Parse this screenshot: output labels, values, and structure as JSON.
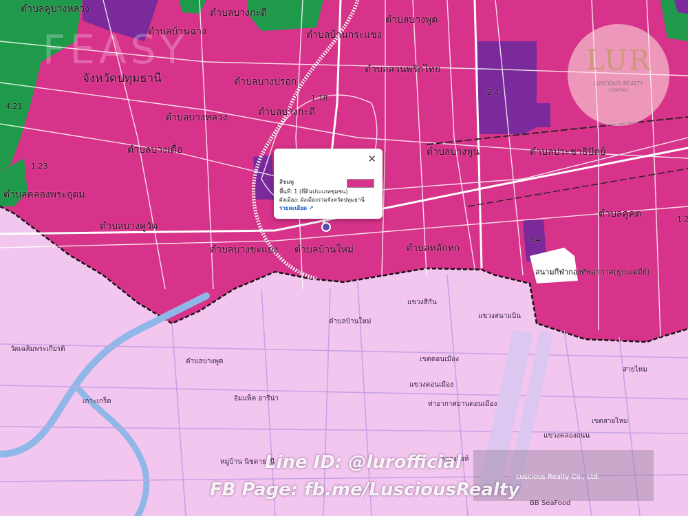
{
  "map": {
    "colors": {
      "residential_medium": "#d8338a",
      "agriculture": "#1f9a4a",
      "institution": "#7a2a9a",
      "basemap": "#f3c6ef",
      "road_white": "#ffffff"
    },
    "zone_labels": [
      "ตำบลคูบางหลวง",
      "ตำบลบ้านฉาง",
      "ตำบลบางกะดี",
      "ตำบลบางพูด",
      "ตำบลบ้านกระแชง",
      "ตำบลบางปรอก",
      "ตำบลสวนพริกไทย",
      "ตำบลบางหลวง",
      "ตำบลบางกะดี",
      "ตำบลบางเดื่อ",
      "ตำบลบางพูน",
      "ตำบลประชาธิปัตย์",
      "ตำบลบางคูวัด",
      "ตำบลบางขะแยง",
      "ตำบลบ้านใหม่",
      "ตำบลหลักหก",
      "ตำบลคูคต",
      "ตำบลคลองพระอุดม",
      "จังหวัดปทุมธานี"
    ],
    "zone_codes": [
      "4.21",
      "1.23",
      "1.18",
      "2.4",
      "3.4",
      "1.2"
    ],
    "basemap_labels": [
      "แขวงสีกัน",
      "แขวงสนามบิน",
      "เขตดอนเมือง",
      "แขวงดอนเมือง",
      "แขวงคลองถนน",
      "เขตสายไหม",
      "ตำบลบางพูด",
      "เกาะเกร็ด",
      "ตำบลบ้านใหม่",
      "สนามกีฬากองทัพอากาศ(ธูปะเตมีย์)",
      "ท่าอากาศยานดอนเมือง",
      "สายไหม"
    ],
    "poi_labels": [
      "วัดเฉลิมพระเกียรติ",
      "คลองสิงห์",
      "อิมแพ็ค อารีน่า",
      "BB SeaFood",
      "หมู่บ้าน นิชดาธานี"
    ]
  },
  "popup": {
    "title": "สีชมพู",
    "line1": "พื้นที่: 1 (ที่ดินประเภทชุมชน)",
    "line2": "ผังเมือง: ผังเมืองรวมจังหวัดปทุมธานี",
    "link": "รายละเอียด ↗",
    "close": "✕"
  },
  "brand": {
    "logo_text": "LUR",
    "logo_sub": "LUSCIOUS REALTY",
    "logo_sub2": "COMPANY",
    "feasy": "FEASY",
    "line_id": "Line ID: @lurofficial",
    "fb_page": "FB Page: fb.me/LusciousRealty",
    "company": "Luscious Realty Co., Ltd."
  }
}
